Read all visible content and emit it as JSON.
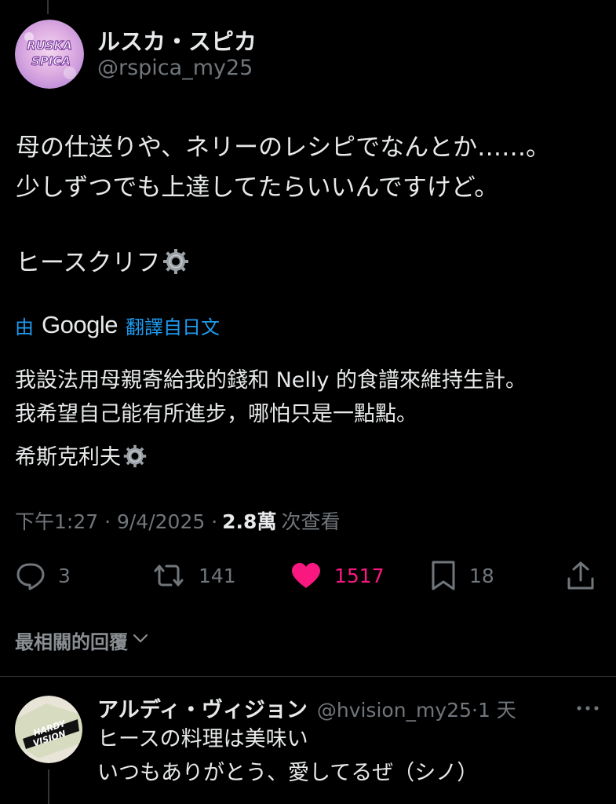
{
  "tweet": {
    "author_name": "ルスカ・スピカ",
    "author_handle": "@rspica_my25",
    "avatar_text": "RUSKA SPICA",
    "text_lines": [
      "母の仕送りや、ネリーのレシピでなんとか……。",
      "少しずつでも上達してたらいいんですけど。"
    ],
    "signature": "ヒースクリフ",
    "translation_prefix": "由",
    "translation_provider": "Google",
    "translation_suffix": "翻譯自日文",
    "translation_lines": [
      "我設法用母親寄給我的錢和 Nelly 的食譜來維持生計。",
      "我希望自己能有所進步，哪怕只是一點點。"
    ],
    "translation_signature": "希斯克利夫",
    "timestamp": "下午1:27 · 9/4/2025 ·",
    "views_count": "2.8萬",
    "views_label": "次查看",
    "replies": "3",
    "retweets": "141",
    "likes": "1517",
    "bookmarks": "18"
  },
  "sort_label": "最相關的回覆",
  "reply": {
    "author_name": "アルディ・ヴィジョン",
    "meta": "@hvision_my25·1 天",
    "avatar_text": "HARDY VISION",
    "text_lines": [
      "ヒースの料理は美味い",
      "いつもありがとう、愛してるぜ（シノ）"
    ]
  },
  "colors": {
    "background": "#000000",
    "text": "#e7e9ea",
    "muted": "#71767b",
    "link": "#1d9bf0",
    "like": "#f91880"
  }
}
